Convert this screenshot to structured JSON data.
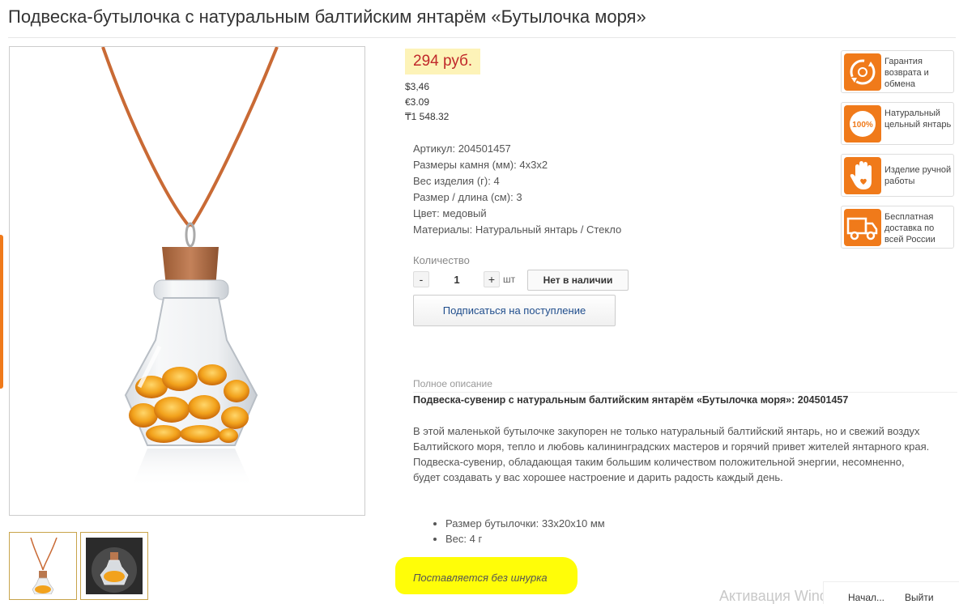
{
  "product": {
    "title": "Подвеска-бутылочка с натуральным балтийским янтарём «Бутылочка моря»"
  },
  "price": {
    "main": "294 руб.",
    "usd": "$3,46",
    "eur": "€3.09",
    "kzt": "₸1 548.32"
  },
  "specs": [
    {
      "label": "Артикул:",
      "value": "204501457"
    },
    {
      "label": "Размеры камня (мм):",
      "value": "4х3х2"
    },
    {
      "label": "Вес изделия (г):",
      "value": "4"
    },
    {
      "label": "Размер / длина (см):",
      "value": "3"
    },
    {
      "label": "Цвет:",
      "value": "медовый"
    },
    {
      "label": "Материалы:",
      "value": "Натуральный янтарь / Стекло"
    }
  ],
  "quantity": {
    "label": "Количество",
    "minus": "-",
    "value": "1",
    "plus": "+",
    "unit": "шт",
    "stock_button": "Нет в наличии",
    "subscribe_button": "Подписаться на поступление"
  },
  "description": {
    "label": "Полное описание",
    "heading": "Подвеска-сувенир с натуральным балтийским янтарём «Бутылочка моря»: 204501457",
    "text": "В этой маленькой бутылочке закупорен не только натуральный балтийский янтарь, но и свежий воздух Балтийского моря, тепло и любовь калининградских мастеров и горячий привет жителей янтарного края. Подвеска-сувенир, обладающая таким большим количеством положительной энергии, несомненно, будет создавать у вас хорошее настроение и дарить радость каждый день.",
    "bullets": [
      "Размер бутылочки: 33х20х10 мм",
      "Вес: 4 г"
    ],
    "note": "Поставляется без шнурка"
  },
  "badges": [
    {
      "icon": "return-guarantee-icon",
      "text": "Гарантия возврата и обмена"
    },
    {
      "icon": "natural-amber-100-icon",
      "text": "Натуральный цельный янтарь",
      "icon_text": "100%"
    },
    {
      "icon": "handmade-hand-icon",
      "text": "Изделие ручной работы"
    },
    {
      "icon": "delivery-truck-icon",
      "text": "Бесплатная доставка по всей России"
    }
  ],
  "system": {
    "watermark": "Активация Windows",
    "start_link": "Начал...",
    "exit_link": "Выйти"
  },
  "colors": {
    "price_red": "#c0282a",
    "price_bg": "#fdf3b8",
    "accent_orange": "#f07a1a",
    "amber": "#f2a21c",
    "link_blue": "#1f4d8c"
  }
}
